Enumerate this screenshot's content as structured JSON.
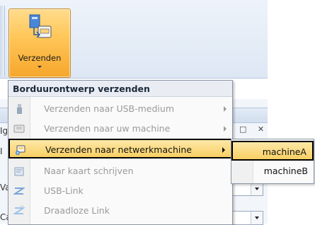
{
  "ribbon": {
    "send_button": {
      "label": "Verzenden",
      "icon": "send-to-machine-icon"
    }
  },
  "background": {
    "fragments": [
      "Ig",
      "I",
      "Va",
      "Ca"
    ]
  },
  "menu": {
    "header": "Borduurontwerp verzenden",
    "items": [
      {
        "label": "Verzenden naar USB-medium",
        "icon": "usb-icon",
        "enabled": false,
        "submenu": true
      },
      {
        "label": "Verzenden naar uw machine",
        "icon": "machine-icon",
        "enabled": false,
        "submenu": true
      },
      {
        "label": "Verzenden naar netwerkmachine",
        "icon": "network-machine-icon",
        "enabled": true,
        "submenu": true,
        "highlighted": true
      },
      {
        "label": "Naar kaart schrijven",
        "icon": "card-icon",
        "enabled": false
      },
      {
        "label": "USB-Link",
        "icon": "usb-link-icon",
        "enabled": false
      },
      {
        "label": "Draadloze Link",
        "icon": "wireless-link-icon",
        "enabled": false
      }
    ]
  },
  "submenu": {
    "items": [
      {
        "label": "machineA",
        "highlighted": true
      },
      {
        "label": "machineB"
      }
    ]
  },
  "colors": {
    "highlight": "#f8cf63",
    "button_active": "#ffc75a",
    "disabled_text": "#9a9a9a"
  }
}
